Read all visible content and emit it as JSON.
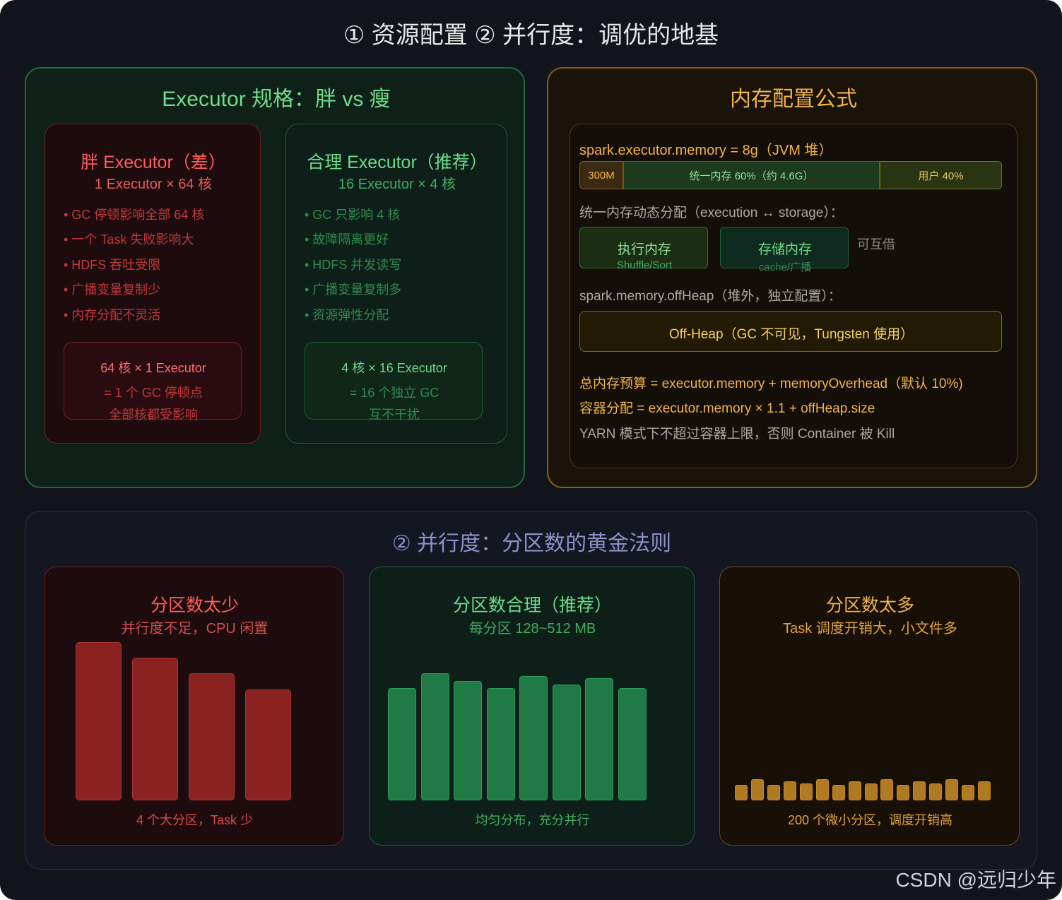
{
  "title": "① 资源配置 ② 并行度：调优的地基",
  "executor": {
    "title": "Executor 规格：胖 vs 瘦",
    "fat": {
      "title": "胖 Executor（差）",
      "subtitle": "1 Executor × 64 核",
      "bullets": [
        "• GC 停顿影响全部 64 核",
        "• 一个 Task 失败影响大",
        "• HDFS 吞吐受限",
        "• 广播变量复制少",
        "• 内存分配不灵活"
      ],
      "box": [
        "64 核 × 1 Executor",
        "= 1 个 GC 停顿点",
        "全部核都受影响"
      ]
    },
    "good": {
      "title": "合理 Executor（推荐）",
      "subtitle": "16 Executor × 4 核",
      "bullets": [
        "• GC 只影响 4 核",
        "• 故障隔离更好",
        "• HDFS 并发读写",
        "• 广播变量复制多",
        "• 资源弹性分配"
      ],
      "box": [
        "4 核 × 16 Executor",
        "= 16 个独立 GC",
        "互不干扰"
      ]
    }
  },
  "memory": {
    "title": "内存配置公式",
    "executor_memory_label": "spark.executor.memory = 8g（JVM 堆）",
    "segments": [
      {
        "label": "300M",
        "color": "#3a2a12"
      },
      {
        "label": "统一内存 60%（约 4.6G）",
        "color": "#1d3a1c"
      },
      {
        "label": "用户 40%",
        "color": "#2a3312"
      }
    ],
    "dynamic_label": "统一内存动态分配（execution ↔ storage）：",
    "exec_mem": {
      "title": "执行内存",
      "sub": "Shuffle/Sort"
    },
    "storage_mem": {
      "title": "存储内存",
      "sub": "cache/广播"
    },
    "borrow": "可互借",
    "offheap_label": "spark.memory.offHeap（堆外，独立配置）：",
    "offheap_box": "Off-Heap（GC 不可见，Tungsten 使用）",
    "formulas": [
      "总内存预算 = executor.memory + memoryOverhead（默认 10%)",
      "容器分配 = executor.memory × 1.1 + offHeap.size",
      "YARN 模式下不超过容器上限，否则 Container 被 Kill"
    ]
  },
  "parallel": {
    "title": "② 并行度：分区数的黄金法则",
    "few": {
      "title": "分区数太少",
      "subtitle": "并行度不足，CPU 闲置",
      "caption": "4 个大分区，Task 少",
      "levels": [
        1.0,
        0.9,
        0.8,
        0.7
      ]
    },
    "good": {
      "title": "分区数合理（推荐）",
      "subtitle": "每分区 128~512 MB",
      "caption": "均匀分布，充分并行",
      "levels": [
        0.88,
        1.0,
        0.94,
        0.88,
        0.98,
        0.91,
        0.96,
        0.88
      ]
    },
    "many": {
      "title": "分区数太多",
      "subtitle": "Task 调度开销大，小文件多",
      "caption": "200 个微小分区，调度开销高",
      "levels": [
        0.7,
        1.0,
        0.7,
        0.9,
        0.8,
        1.0,
        0.7,
        0.9,
        0.8,
        1.0,
        0.7,
        0.9,
        0.8,
        1.0,
        0.7,
        0.9
      ]
    },
    "colors": {
      "red": "#8b2222",
      "green": "#1f7a46",
      "gold": "#b07a23"
    }
  },
  "watermark": "CSDN @远归少年"
}
